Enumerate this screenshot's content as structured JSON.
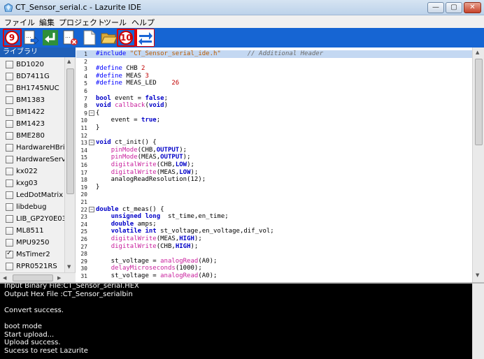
{
  "window": {
    "title": "CT_Sensor_serial.c - Lazurite IDE",
    "controls": {
      "minimize": "—",
      "maximize": "▢",
      "close": "✕"
    }
  },
  "menu": [
    "ファイル",
    "編集",
    "プロジェクト",
    "ツール",
    "ヘルプ"
  ],
  "toolbar": {
    "buttons": [
      "new-file-icon",
      "import-icon",
      "return-icon",
      "close-file-icon",
      "blank-page-icon",
      "open-folder-icon",
      "transfer-icon"
    ],
    "markers": [
      "9",
      "10"
    ]
  },
  "library": {
    "header": "ライブラリ",
    "items": [
      {
        "label": "BD1020",
        "checked": false
      },
      {
        "label": "BD7411G",
        "checked": false
      },
      {
        "label": "BH1745NUC",
        "checked": false
      },
      {
        "label": "BM1383",
        "checked": false
      },
      {
        "label": "BM1422",
        "checked": false
      },
      {
        "label": "BM1423",
        "checked": false
      },
      {
        "label": "BME280",
        "checked": false
      },
      {
        "label": "HardwareHBridge",
        "checked": false
      },
      {
        "label": "HardwareServo",
        "checked": false
      },
      {
        "label": "kx022",
        "checked": false
      },
      {
        "label": "kxg03",
        "checked": false
      },
      {
        "label": "LedDotMatrix",
        "checked": false
      },
      {
        "label": "libdebug",
        "checked": false
      },
      {
        "label": "LIB_GP2Y0E03",
        "checked": false
      },
      {
        "label": "ML8511",
        "checked": false
      },
      {
        "label": "MPU9250",
        "checked": false
      },
      {
        "label": "MsTimer2",
        "checked": true
      },
      {
        "label": "RPR0521RS",
        "checked": false
      }
    ]
  },
  "editor": {
    "lines": [
      {
        "n": "1",
        "text": "#include \"CT_Sensor_serial_ide.h\"       // Additional Header"
      },
      {
        "n": "2",
        "text": ""
      },
      {
        "n": "3",
        "text": "#define CHB 2"
      },
      {
        "n": "4",
        "text": "#define MEAS 3"
      },
      {
        "n": "5",
        "text": "#define MEAS_LED    26"
      },
      {
        "n": "6",
        "text": ""
      },
      {
        "n": "7",
        "text": "bool event = false;"
      },
      {
        "n": "8",
        "text": "void callback(void)"
      },
      {
        "n": "9",
        "text": "{"
      },
      {
        "n": "10",
        "text": "    event = true;"
      },
      {
        "n": "11",
        "text": "}"
      },
      {
        "n": "12",
        "text": ""
      },
      {
        "n": "13",
        "text": "void ct_init() {"
      },
      {
        "n": "14",
        "text": "    pinMode(CHB,OUTPUT);"
      },
      {
        "n": "15",
        "text": "    pinMode(MEAS,OUTPUT);"
      },
      {
        "n": "16",
        "text": "    digitalWrite(CHB,LOW);"
      },
      {
        "n": "17",
        "text": "    digitalWrite(MEAS,LOW);"
      },
      {
        "n": "18",
        "text": "    analogReadResolution(12);"
      },
      {
        "n": "19",
        "text": "}"
      },
      {
        "n": "20",
        "text": ""
      },
      {
        "n": "21",
        "text": ""
      },
      {
        "n": "22",
        "text": "double ct_meas() {"
      },
      {
        "n": "23",
        "text": "    unsigned long  st_time,en_time;"
      },
      {
        "n": "24",
        "text": "    double amps;"
      },
      {
        "n": "25",
        "text": "    volatile int st_voltage,en_voltage,dif_vol;"
      },
      {
        "n": "26",
        "text": "    digitalWrite(MEAS,HIGH);"
      },
      {
        "n": "27",
        "text": "    digitalWrite(CHB,HIGH);"
      },
      {
        "n": "28",
        "text": ""
      },
      {
        "n": "29",
        "text": "    st_voltage = analogRead(A0);"
      },
      {
        "n": "30",
        "text": "    delayMicroseconds(1000);"
      },
      {
        "n": "31",
        "text": "    st_voltage = analogRead(A0);"
      }
    ]
  },
  "console": {
    "lines": [
      "Input Binary File:CT_Sensor_serial.HEX",
      "Output Hex File  :CT_Sensor_serialbin",
      "",
      "Convert success.",
      "",
      "boot mode",
      "Start upload...",
      "Upload success.",
      "Sucess to reset Lazurite"
    ]
  }
}
